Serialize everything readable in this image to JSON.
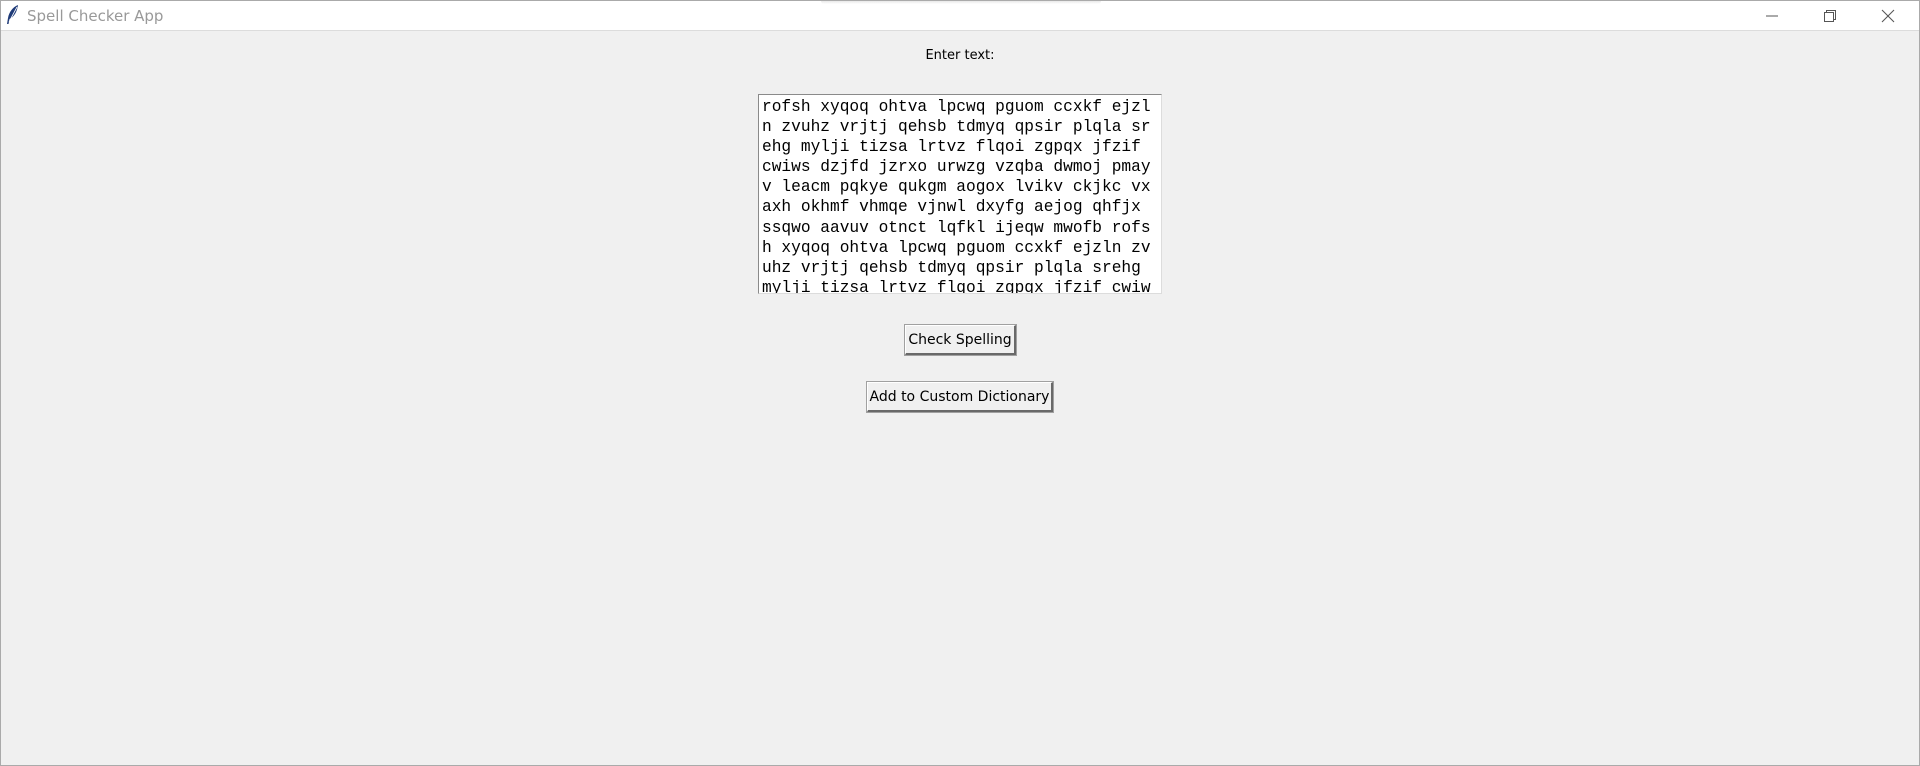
{
  "window": {
    "title": "Spell Checker App",
    "app_icon": "feather-icon",
    "controls": {
      "minimize_icon": "minimize-icon",
      "restore_icon": "restore-icon",
      "close_icon": "close-icon"
    }
  },
  "form": {
    "label": "Enter text:",
    "text_lines": [
      "rofsh xyqoq ohtva lpcwq pguom ccxkf ejzl",
      "n zvuhz vrjtj qehsb tdmyq qpsir plqla sr",
      "ehg mylji tizsa lrtvz flqoi zgpqx jfzif ",
      "cwiws dzjfd jzrxo urwzg vzqba dwmoj pmay",
      "v leacm pqkye qukgm aogox lvikv ckjkc vx",
      "axh okhmf vhmqe vjnwl dxyfg aejog qhfjx ",
      "ssqwo aavuv otnct lqfkl ijeqw mwofb rofs",
      "h xyqoq ohtva lpcwq pguom ccxkf ejzln zv",
      "uhz vrjtj qehsb tdmyq qpsir plqla srehg ",
      "mylji tizsa lrtvz flqoi zgpqx jfzif cwiw"
    ],
    "check_button": "Check Spelling",
    "add_button": "Add to Custom Dictionary"
  },
  "colors": {
    "background": "#f0f0f0",
    "titlebar": "#ffffff",
    "title_text": "#999999",
    "textbox_bg": "#ffffff",
    "feather_icon": "#1f3b78"
  }
}
